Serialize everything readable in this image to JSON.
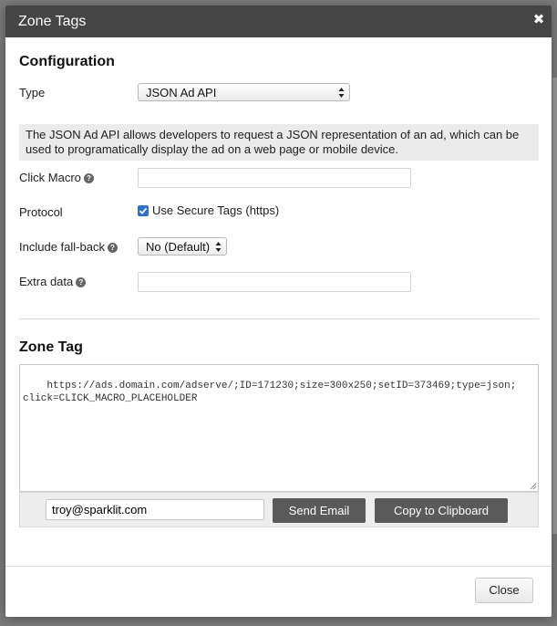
{
  "dialog": {
    "title": "Zone Tags",
    "close_glyph": "✖"
  },
  "configuration": {
    "heading": "Configuration",
    "type_label": "Type",
    "type_value": "JSON Ad API",
    "description": "The JSON Ad API allows developers to request a JSON representation of an ad, which can be used to programatically display the ad on a web page or mobile device.",
    "click_macro_label": "Click Macro",
    "click_macro_value": "",
    "protocol_label": "Protocol",
    "protocol_checkbox_label": "Use Secure Tags (https)",
    "protocol_checked": true,
    "fallback_label": "Include fall-back",
    "fallback_value": "No (Default)",
    "extra_data_label": "Extra data",
    "extra_data_value": "",
    "help_glyph": "?"
  },
  "zone_tag": {
    "heading": "Zone Tag",
    "code": "https://ads.domain.com/adserve/;ID=171230;size=300x250;setID=373469;type=json;\nclick=CLICK_MACRO_PLACEHOLDER",
    "email_value": "troy@sparklit.com",
    "send_email_label": "Send Email",
    "copy_label": "Copy to Clipboard"
  },
  "footer": {
    "close_label": "Close"
  },
  "colors": {
    "header": "#454545",
    "checkbox": "#2f6fce",
    "button_dark": "#5a5a5a"
  }
}
